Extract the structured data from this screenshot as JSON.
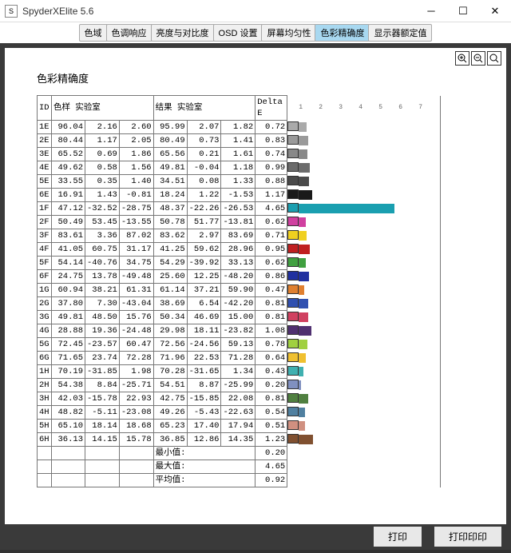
{
  "window": {
    "title": "SpyderXElite 5.6"
  },
  "tabs": [
    "色域",
    "色调响应",
    "亮度与对比度",
    "OSD 设置",
    "屏幕均匀性",
    "色彩精确度",
    "显示器额定值"
  ],
  "active_tab": 5,
  "heading": "色彩精确度",
  "headers": {
    "id": "ID",
    "sample": "色样 实验室",
    "result": "结果 实验室",
    "delta": "Delta E"
  },
  "axis_ticks": [
    "1",
    "2",
    "3",
    "4",
    "5",
    "6",
    "7"
  ],
  "summary": {
    "min_label": "最小值:",
    "min": "0.20",
    "max_label": "最大值:",
    "max": "4.65",
    "avg_label": "平均值:",
    "avg": "0.92"
  },
  "footer": {
    "print": "打印",
    "print_all": "打印印印"
  },
  "rows": [
    {
      "id": "1E",
      "s": [
        "96.04",
        "2.16",
        "2.60"
      ],
      "r": [
        "95.99",
        "2.07",
        "1.82"
      ],
      "d": "0.72",
      "color": "#aaaaaa",
      "bar": 10
    },
    {
      "id": "2E",
      "s": [
        "80.44",
        "1.17",
        "2.05"
      ],
      "r": [
        "80.49",
        "0.73",
        "1.41"
      ],
      "d": "0.83",
      "color": "#9a9a9a",
      "bar": 12
    },
    {
      "id": "3E",
      "s": [
        "65.52",
        "0.69",
        "1.86"
      ],
      "r": [
        "65.56",
        "0.21",
        "1.61"
      ],
      "d": "0.74",
      "color": "#888888",
      "bar": 11
    },
    {
      "id": "4E",
      "s": [
        "49.62",
        "0.58",
        "1.56"
      ],
      "r": [
        "49.81",
        "-0.04",
        "1.18"
      ],
      "d": "0.99",
      "color": "#6b6b6b",
      "bar": 14
    },
    {
      "id": "5E",
      "s": [
        "33.55",
        "0.35",
        "1.40"
      ],
      "r": [
        "34.51",
        "0.08",
        "1.33"
      ],
      "d": "0.88",
      "color": "#4a4a4a",
      "bar": 13
    },
    {
      "id": "6E",
      "s": [
        "16.91",
        "1.43",
        "-0.81"
      ],
      "r": [
        "18.24",
        "1.22",
        "-1.53"
      ],
      "d": "1.17",
      "color": "#1a1a1a",
      "bar": 17
    },
    {
      "id": "1F",
      "s": [
        "47.12",
        "-32.52",
        "-28.75"
      ],
      "r": [
        "48.37",
        "-22.26",
        "-26.53"
      ],
      "d": "4.65",
      "color": "#1a9fb0",
      "bar": 120
    },
    {
      "id": "2F",
      "s": [
        "50.49",
        "53.45",
        "-13.55"
      ],
      "r": [
        "50.78",
        "51.77",
        "-13.81"
      ],
      "d": "0.62",
      "color": "#d040a0",
      "bar": 9
    },
    {
      "id": "3F",
      "s": [
        "83.61",
        "3.36",
        "87.02"
      ],
      "r": [
        "83.62",
        "2.97",
        "83.69"
      ],
      "d": "0.71",
      "color": "#f0d020",
      "bar": 10
    },
    {
      "id": "4F",
      "s": [
        "41.05",
        "60.75",
        "31.17"
      ],
      "r": [
        "41.25",
        "59.62",
        "28.96"
      ],
      "d": "0.95",
      "color": "#c02020",
      "bar": 14
    },
    {
      "id": "5F",
      "s": [
        "54.14",
        "-40.76",
        "34.75"
      ],
      "r": [
        "54.29",
        "-39.92",
        "33.13"
      ],
      "d": "0.62",
      "color": "#40a040",
      "bar": 9
    },
    {
      "id": "6F",
      "s": [
        "24.75",
        "13.78",
        "-49.48"
      ],
      "r": [
        "25.60",
        "12.25",
        "-48.20"
      ],
      "d": "0.86",
      "color": "#2030a0",
      "bar": 13
    },
    {
      "id": "1G",
      "s": [
        "60.94",
        "38.21",
        "61.31"
      ],
      "r": [
        "61.14",
        "37.21",
        "59.90"
      ],
      "d": "0.47",
      "color": "#e08030",
      "bar": 7
    },
    {
      "id": "2G",
      "s": [
        "37.80",
        "7.30",
        "-43.04"
      ],
      "r": [
        "38.69",
        "6.54",
        "-42.20"
      ],
      "d": "0.81",
      "color": "#3050b0",
      "bar": 12
    },
    {
      "id": "3G",
      "s": [
        "49.81",
        "48.50",
        "15.76"
      ],
      "r": [
        "50.34",
        "46.69",
        "15.00"
      ],
      "d": "0.81",
      "color": "#d04060",
      "bar": 12
    },
    {
      "id": "4G",
      "s": [
        "28.88",
        "19.36",
        "-24.48"
      ],
      "r": [
        "29.98",
        "18.11",
        "-23.82"
      ],
      "d": "1.08",
      "color": "#503070",
      "bar": 16
    },
    {
      "id": "5G",
      "s": [
        "72.45",
        "-23.57",
        "60.47"
      ],
      "r": [
        "72.56",
        "-24.56",
        "59.13"
      ],
      "d": "0.78",
      "color": "#a0d040",
      "bar": 11
    },
    {
      "id": "6G",
      "s": [
        "71.65",
        "23.74",
        "72.28"
      ],
      "r": [
        "71.96",
        "22.53",
        "71.28"
      ],
      "d": "0.64",
      "color": "#f0c030",
      "bar": 9
    },
    {
      "id": "1H",
      "s": [
        "70.19",
        "-31.85",
        "1.98"
      ],
      "r": [
        "70.28",
        "-31.65",
        "1.34"
      ],
      "d": "0.43",
      "color": "#40b0b0",
      "bar": 6
    },
    {
      "id": "2H",
      "s": [
        "54.38",
        "8.84",
        "-25.71"
      ],
      "r": [
        "54.51",
        "8.87",
        "-25.99"
      ],
      "d": "0.20",
      "color": "#8090c0",
      "bar": 3
    },
    {
      "id": "3H",
      "s": [
        "42.03",
        "-15.78",
        "22.93"
      ],
      "r": [
        "42.75",
        "-15.85",
        "22.08"
      ],
      "d": "0.81",
      "color": "#508040",
      "bar": 12
    },
    {
      "id": "4H",
      "s": [
        "48.82",
        "-5.11",
        "-23.08"
      ],
      "r": [
        "49.26",
        "-5.43",
        "-22.63"
      ],
      "d": "0.54",
      "color": "#5080a0",
      "bar": 8
    },
    {
      "id": "5H",
      "s": [
        "65.10",
        "18.14",
        "18.68"
      ],
      "r": [
        "65.23",
        "17.40",
        "17.94"
      ],
      "d": "0.51",
      "color": "#d09080",
      "bar": 8
    },
    {
      "id": "6H",
      "s": [
        "36.13",
        "14.15",
        "15.78"
      ],
      "r": [
        "36.85",
        "12.86",
        "14.35"
      ],
      "d": "1.23",
      "color": "#805030",
      "bar": 18
    }
  ]
}
